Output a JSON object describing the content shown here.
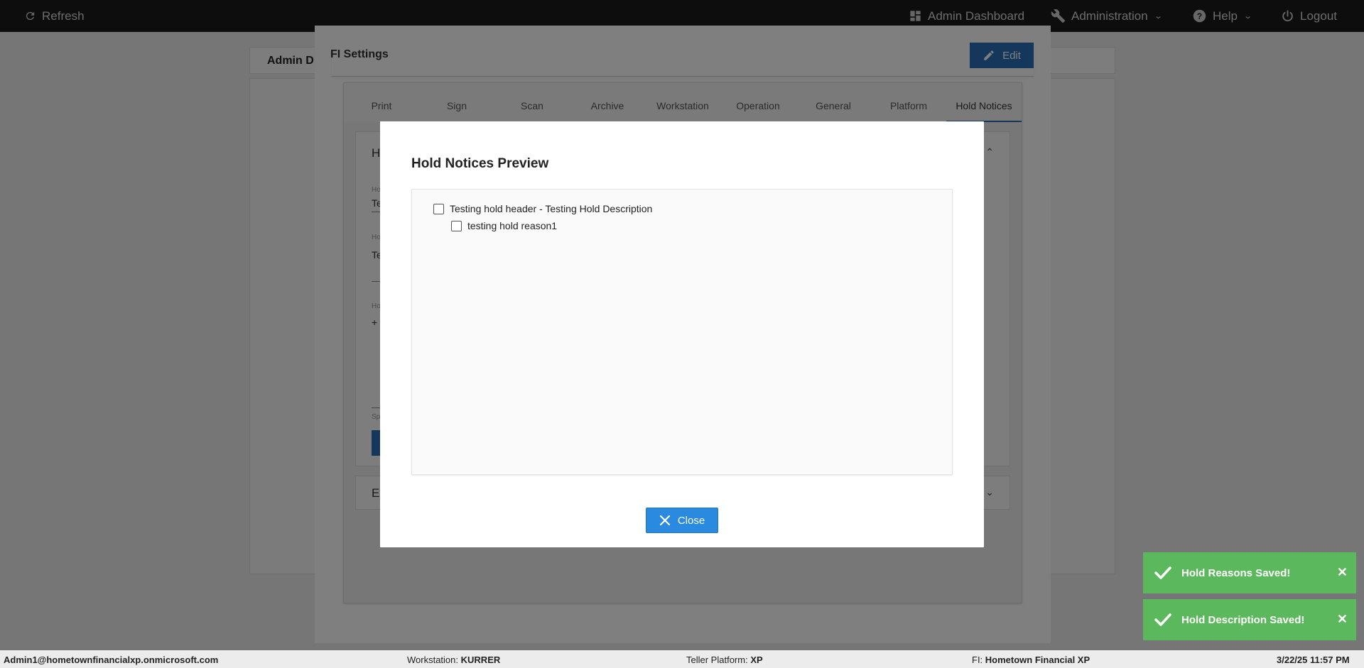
{
  "topbar": {
    "refresh": "Refresh",
    "admin_dashboard": "Admin Dashboard",
    "administration": "Administration",
    "help": "Help",
    "logout": "Logout"
  },
  "background": {
    "page_tab": "Admin D",
    "card1_letter": "H",
    "card2_letter": "E",
    "field1_label": "Ho",
    "field1_value": "Te",
    "field2_label": "Ho",
    "field2_value": "Te",
    "field3_label": "Ho",
    "field3_value": "+",
    "field4_label": "Sp"
  },
  "fi_settings": {
    "title": "FI Settings",
    "edit_label": "Edit",
    "tabs": [
      "Print",
      "Sign",
      "Scan",
      "Archive",
      "Workstation",
      "Operation",
      "General",
      "Platform",
      "Hold Notices"
    ],
    "active_tab": "Hold Notices"
  },
  "modal": {
    "title": "Hold Notices Preview",
    "header_item": "Testing hold header - Testing Hold Description",
    "reason_item": "testing hold reason1",
    "close_label": "Close"
  },
  "toasts": [
    {
      "message": "Hold Reasons Saved!"
    },
    {
      "message": "Hold Description Saved!"
    }
  ],
  "statusbar": {
    "user": "Admin1@hometownfinancialxp.onmicrosoft.com",
    "workstation_label": "Workstation:",
    "workstation_value": "KURRER",
    "platform_label": "Teller Platform:",
    "platform_value": "XP",
    "fi_label": "FI:",
    "fi_value": "Hometown Financial XP",
    "datetime": "3/22/25 11:57 PM"
  },
  "colors": {
    "primary": "#2a6fb8",
    "close_button": "#2a8ae0",
    "toast_success": "#5cb85c",
    "topbar_bg": "#1b1b1b"
  }
}
